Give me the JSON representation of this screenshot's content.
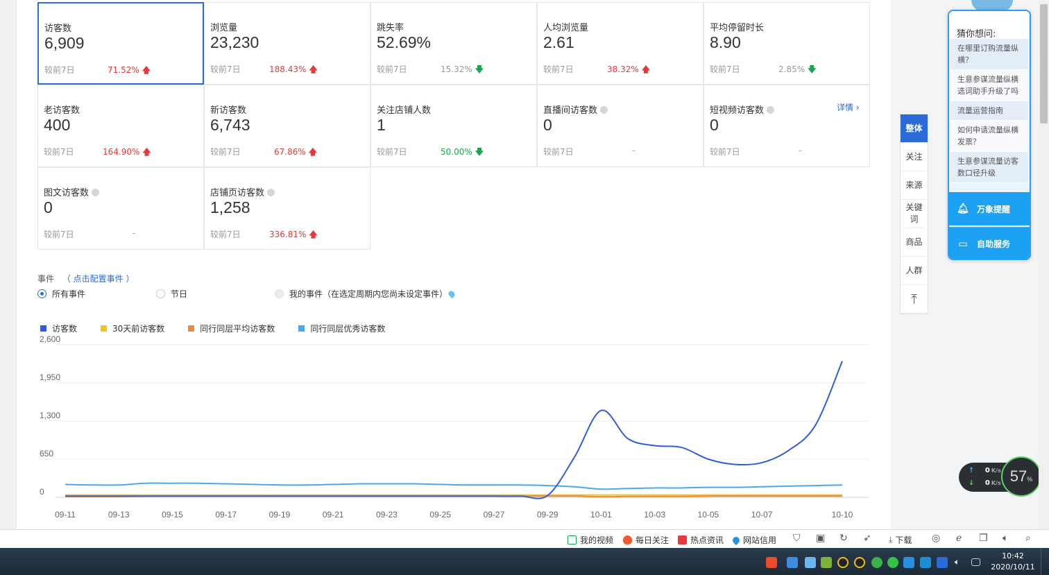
{
  "metrics": [
    {
      "title": "访客数",
      "value": "6,909",
      "compare": "较前7日",
      "change": "71.52%",
      "dir": "up",
      "info": false
    },
    {
      "title": "浏览量",
      "value": "23,230",
      "compare": "较前7日",
      "change": "188.43%",
      "dir": "up",
      "info": false
    },
    {
      "title": "跳失率",
      "value": "52.69%",
      "compare": "较前7日",
      "change": "15.32%",
      "dir": "down",
      "info": false
    },
    {
      "title": "人均浏览量",
      "value": "2.61",
      "compare": "较前7日",
      "change": "38.32%",
      "dir": "up",
      "info": false
    },
    {
      "title": "平均停留时长",
      "value": "8.90",
      "compare": "较前7日",
      "change": "2.85%",
      "dir": "down",
      "info": false
    },
    {
      "title": "老访客数",
      "value": "400",
      "compare": "较前7日",
      "change": "164.90%",
      "dir": "up",
      "info": false
    },
    {
      "title": "新访客数",
      "value": "6,743",
      "compare": "较前7日",
      "change": "67.86%",
      "dir": "up",
      "info": false
    },
    {
      "title": "关注店铺人数",
      "value": "1",
      "compare": "较前7日",
      "change": "50.00%",
      "dir": "down-green",
      "info": false
    },
    {
      "title": "直播间访客数",
      "value": "0",
      "compare": "较前7日",
      "change": "-",
      "dir": "none",
      "info": true
    },
    {
      "title": "短视频访客数",
      "value": "0",
      "compare": "较前7日",
      "change": "-",
      "dir": "none",
      "info": true
    },
    {
      "title": "图文访客数",
      "value": "0",
      "compare": "较前7日",
      "change": "-",
      "dir": "none",
      "info": true
    },
    {
      "title": "店铺页访客数",
      "value": "1,258",
      "compare": "较前7日",
      "change": "336.81%",
      "dir": "up",
      "info": true
    }
  ],
  "detail_link": "详情",
  "events": {
    "label": "事件",
    "config_link": "（ 点击配置事件 ）",
    "options": [
      "所有事件",
      "节日",
      "我的事件（在选定周期内您尚未设定事件）"
    ]
  },
  "side_tabs": [
    "整体",
    "关注",
    "来源",
    "关键词",
    "商品",
    "人群"
  ],
  "assistant": {
    "heading": "猜你想问:",
    "questions": [
      "在哪里订购流量纵横？",
      "生意参谋流量纵横选词助手升级了吗",
      "流量运营指南",
      "如何申请流量纵横发票？",
      "生意参谋流量访客数口径升级"
    ],
    "btn_alert": "万象提醒",
    "btn_service": "自助服务"
  },
  "speed": {
    "up": "0",
    "down": "0",
    "unit": "K/s",
    "percent": "57",
    "pct_sign": "%"
  },
  "statusbar": [
    "我的视频",
    "每日关注",
    "热点资讯",
    "网站信用",
    "下载"
  ],
  "clock": {
    "time": "10:42",
    "date": "2020/10/11"
  },
  "colors": {
    "primary": "#2a6bd8",
    "up": "#e43a3a",
    "down": "#16a84b",
    "visitor": "#2b5fd9",
    "days30": "#f2c418",
    "peer_avg": "#f08a3a",
    "peer_top": "#4aa8ee"
  },
  "chart_data": {
    "type": "line",
    "x": [
      "09-11",
      "09-12",
      "09-13",
      "09-14",
      "09-15",
      "09-16",
      "09-17",
      "09-18",
      "09-19",
      "09-20",
      "09-21",
      "09-22",
      "09-23",
      "09-24",
      "09-25",
      "09-26",
      "09-27",
      "09-28",
      "09-29",
      "09-30",
      "10-01",
      "10-02",
      "10-03",
      "10-04",
      "10-05",
      "10-06",
      "10-07",
      "10-08",
      "10-09",
      "10-10"
    ],
    "x_tick_labels": [
      "09-11",
      "09-13",
      "09-15",
      "09-17",
      "09-19",
      "09-21",
      "09-23",
      "09-25",
      "09-27",
      "09-29",
      "10-01",
      "10-03",
      "10-05",
      "10-07",
      "10-10"
    ],
    "ylim": [
      0,
      2600
    ],
    "y_ticks": [
      "0",
      "650",
      "1,300",
      "1,950",
      "2,600"
    ],
    "grid": true,
    "legend": "top-left",
    "series": [
      {
        "name": "访客数",
        "color": "#2b5fd9",
        "values": [
          20,
          20,
          20,
          20,
          20,
          20,
          20,
          20,
          20,
          20,
          20,
          20,
          20,
          20,
          20,
          20,
          20,
          20,
          30,
          680,
          1480,
          1000,
          880,
          850,
          650,
          560,
          590,
          800,
          1230,
          2320
        ]
      },
      {
        "name": "30天前访客数",
        "color": "#f2c418",
        "values": [
          40,
          40,
          40,
          40,
          40,
          40,
          40,
          40,
          40,
          40,
          40,
          40,
          40,
          40,
          40,
          40,
          40,
          40,
          40,
          40,
          40,
          40,
          40,
          40,
          40,
          40,
          40,
          40,
          40,
          40
        ]
      },
      {
        "name": "同行同层平均访客数",
        "color": "#f08a3a",
        "values": [
          15,
          15,
          15,
          20,
          20,
          20,
          20,
          20,
          20,
          20,
          20,
          20,
          20,
          20,
          20,
          20,
          20,
          20,
          20,
          20,
          10,
          15,
          15,
          15,
          20,
          20,
          20,
          20,
          20,
          20
        ]
      },
      {
        "name": "同行同层优秀访客数",
        "color": "#4aa8ee",
        "values": [
          220,
          210,
          210,
          240,
          240,
          240,
          230,
          220,
          210,
          210,
          220,
          230,
          230,
          230,
          220,
          210,
          210,
          210,
          200,
          180,
          140,
          150,
          160,
          160,
          170,
          170,
          180,
          190,
          200,
          210
        ]
      }
    ]
  }
}
